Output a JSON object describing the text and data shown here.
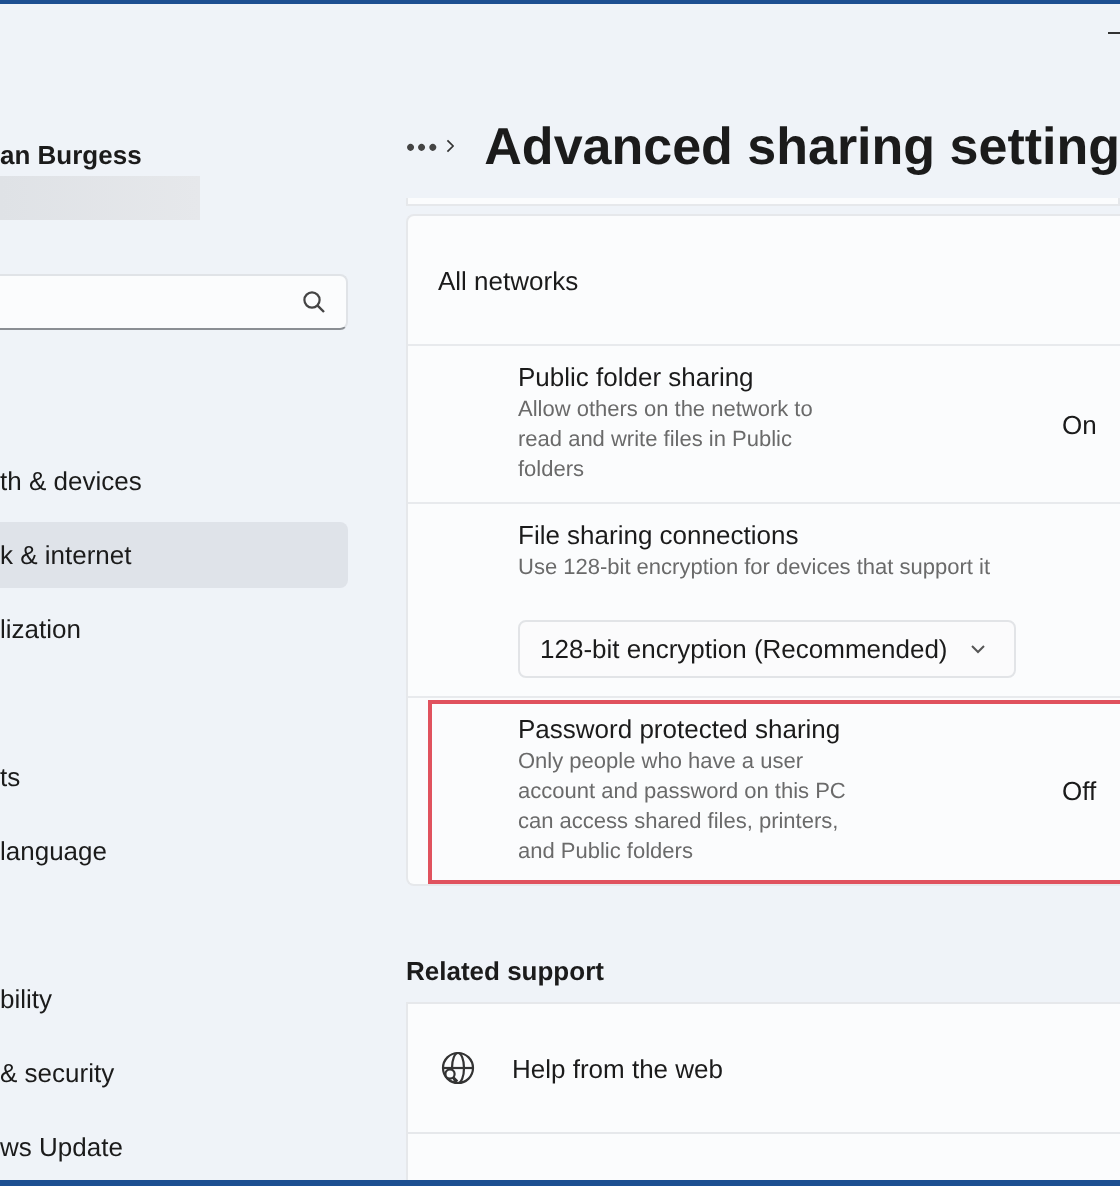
{
  "sidebar": {
    "user_name": "an Burgess",
    "nav_groups": [
      {
        "items": [
          {
            "label": "th & devices",
            "selected": false
          },
          {
            "label": "k & internet",
            "selected": true
          },
          {
            "label": "lization",
            "selected": false
          }
        ]
      },
      {
        "items": [
          {
            "label": "ts",
            "selected": false
          },
          {
            "label": "language",
            "selected": false
          }
        ]
      },
      {
        "items": [
          {
            "label": "bility",
            "selected": false
          },
          {
            "label": "& security",
            "selected": false
          },
          {
            "label": "ws Update",
            "selected": false
          }
        ]
      }
    ]
  },
  "header": {
    "breadcrumb_more": "•••",
    "title": "Advanced sharing setting"
  },
  "section": {
    "title": "All networks",
    "rows": [
      {
        "kind": "toggle",
        "title": "Public folder sharing",
        "description": "Allow others on the network to read and write files in Public folders",
        "value": "On",
        "highlighted": false
      },
      {
        "kind": "dropdown",
        "title": "File sharing connections",
        "description": "Use 128-bit encryption for devices that support it",
        "value": "128-bit encryption (Recommended)",
        "highlighted": false
      },
      {
        "kind": "toggle",
        "title": "Password protected sharing",
        "description": "Only people who have a user account and password on this PC can access shared files, printers, and Public folders",
        "value": "Off",
        "highlighted": true
      }
    ]
  },
  "related_support": {
    "title": "Related support",
    "items": [
      {
        "label": "Help from the web"
      }
    ]
  }
}
